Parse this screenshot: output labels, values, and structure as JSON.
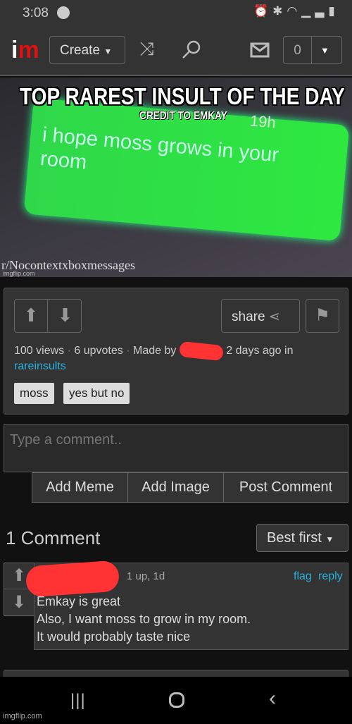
{
  "status_bar": {
    "time": "3:08",
    "icons": [
      "spotify-icon",
      "alarm-icon",
      "bluetooth-icon",
      "wifi-icon",
      "signal-icon",
      "battery-charging-icon"
    ]
  },
  "header": {
    "logo": "im",
    "create_label": "Create",
    "notification_count": "0",
    "icons": [
      "shuffle-icon",
      "search-icon",
      "mail-icon",
      "chevron-down-icon"
    ]
  },
  "meme": {
    "title": "TOP RAREST INSULT OF THE DAY",
    "credit": "CREDIT TO EMKAY",
    "timestamp": "19h",
    "message": "i hope moss grows in your room",
    "source": "r/Nocontextxboxmessages",
    "watermark": "imgflip.com"
  },
  "post": {
    "share_label": "share",
    "views": "100 views",
    "upvotes": "6 upvotes",
    "made_by": "Made by",
    "time_ago": "2 days ago in",
    "stream": "rareinsults",
    "tags": [
      "moss",
      "yes but no"
    ]
  },
  "comment_box": {
    "placeholder": "Type a comment..",
    "buttons": [
      "Add Meme",
      "Add Image",
      "Post Comment"
    ]
  },
  "comments": {
    "count_label": "1 Comment",
    "sort_label": "Best first",
    "items": [
      {
        "meta": "1 up, 1d",
        "flag": "flag",
        "reply": "reply",
        "lines": [
          "Emkay is great",
          "Also, I want moss to grow in my room.",
          "It would probably taste nice"
        ]
      }
    ]
  },
  "footer": {
    "watermark": "imgflip.com"
  },
  "colors": {
    "accent": "#2ab0e0",
    "logo_red": "#e01010",
    "redaction": "#ff3333",
    "bubble_green": "#2fd84a"
  }
}
